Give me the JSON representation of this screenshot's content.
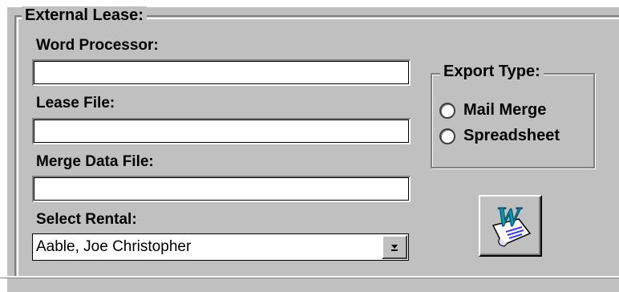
{
  "group": {
    "title": "External Lease:"
  },
  "word_processor": {
    "label": "Word Processor:",
    "value": ""
  },
  "lease_file": {
    "label": "Lease File:",
    "value": ""
  },
  "merge_data_file": {
    "label": "Merge Data File:",
    "value": ""
  },
  "select_rental": {
    "label": "Select Rental:",
    "selected": "Aable, Joe Christopher"
  },
  "export_type": {
    "title": "Export Type:",
    "options": [
      "Mail Merge",
      "Spreadsheet"
    ]
  },
  "icons": {
    "dropdown": "chevron-down-icon",
    "launch": "word-document-icon"
  },
  "colors": {
    "face": "#c0c0c0",
    "shadow": "#808080",
    "highlight": "#ffffff"
  }
}
